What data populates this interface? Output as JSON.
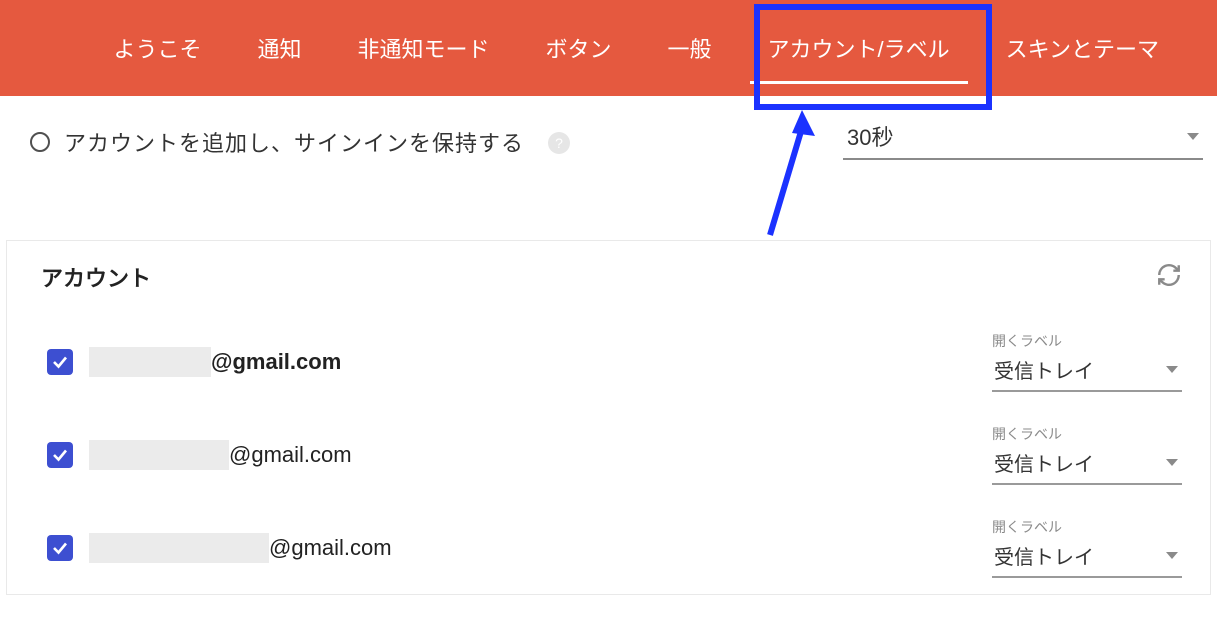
{
  "tabs": [
    {
      "label": "ようこそ",
      "active": false
    },
    {
      "label": "通知",
      "active": false
    },
    {
      "label": "非通知モード",
      "active": false
    },
    {
      "label": "ボタン",
      "active": false
    },
    {
      "label": "一般",
      "active": false
    },
    {
      "label": "アカウント/ラベル",
      "active": true
    },
    {
      "label": "スキンとテーマ",
      "active": false
    }
  ],
  "addAccount": {
    "label": "アカウントを追加し、サインインを保持する",
    "help": "?"
  },
  "interval": {
    "value": "30秒"
  },
  "panel": {
    "title": "アカウント"
  },
  "accounts": [
    {
      "redactWidth": 122,
      "domain": "@gmail.com",
      "openLabelTitle": "開くラベル",
      "openLabelValue": "受信トレイ"
    },
    {
      "redactWidth": 140,
      "domain": "@gmail.com",
      "openLabelTitle": "開くラベル",
      "openLabelValue": "受信トレイ"
    },
    {
      "redactWidth": 180,
      "domain": "@gmail.com",
      "openLabelTitle": "開くラベル",
      "openLabelValue": "受信トレイ"
    }
  ]
}
